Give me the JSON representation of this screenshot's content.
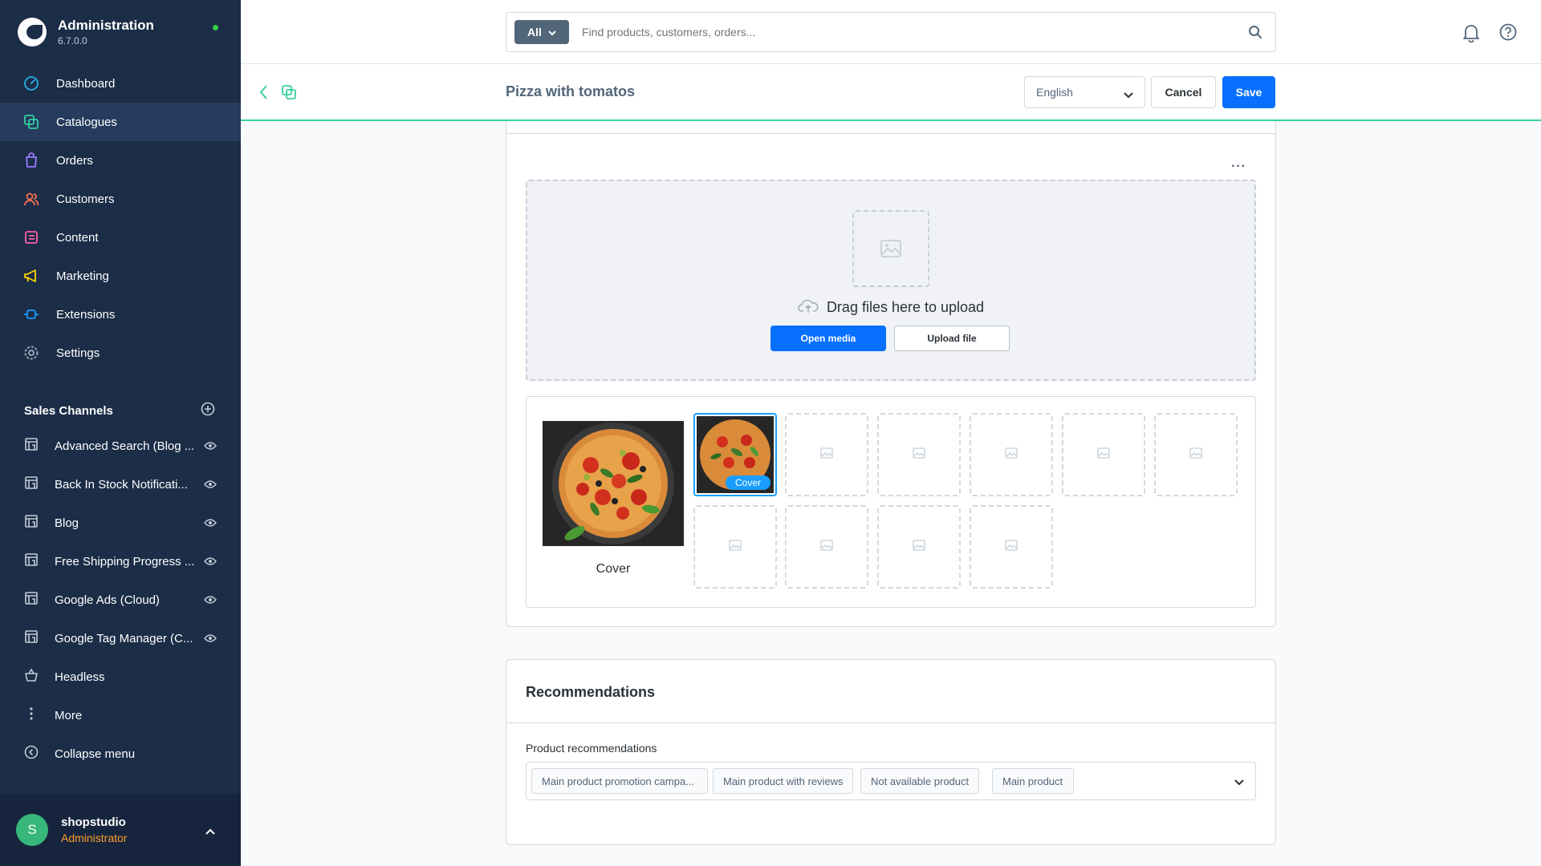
{
  "app": {
    "name": "Administration",
    "version": "6.7.0.0"
  },
  "nav": {
    "items": [
      {
        "label": "Dashboard",
        "icon": "dashboard-icon"
      },
      {
        "label": "Catalogues",
        "icon": "catalogues-icon"
      },
      {
        "label": "Orders",
        "icon": "orders-icon"
      },
      {
        "label": "Customers",
        "icon": "customers-icon"
      },
      {
        "label": "Content",
        "icon": "content-icon"
      },
      {
        "label": "Marketing",
        "icon": "marketing-icon"
      },
      {
        "label": "Extensions",
        "icon": "extensions-icon"
      },
      {
        "label": "Settings",
        "icon": "settings-icon"
      }
    ],
    "active": "Catalogues"
  },
  "sales_channels": {
    "title": "Sales Channels",
    "items": [
      {
        "label": "Advanced Search (Blog ..."
      },
      {
        "label": "Back In Stock Notificati..."
      },
      {
        "label": "Blog"
      },
      {
        "label": "Free Shipping Progress ..."
      },
      {
        "label": "Google Ads (Cloud)"
      },
      {
        "label": "Google Tag Manager (C..."
      },
      {
        "label": "Headless"
      }
    ],
    "more_label": "More",
    "collapse_label": "Collapse menu"
  },
  "user": {
    "initial": "S",
    "name": "shopstudio",
    "role": "Administrator"
  },
  "search": {
    "type": "All",
    "placeholder": "Find products, customers, orders..."
  },
  "smartbar": {
    "title": "Pizza with tomatos",
    "language": "English",
    "cancel_label": "Cancel",
    "save_label": "Save"
  },
  "media": {
    "dropzone_text": "Drag files here to upload",
    "open_media_label": "Open media",
    "upload_file_label": "Upload file",
    "cover_label": "Cover",
    "cover_badge": "Cover"
  },
  "recommendations": {
    "title": "Recommendations",
    "field_label": "Product recommendations",
    "tags": [
      "Main product promotion campa...",
      "Main product with reviews",
      "Not available product",
      "Main product"
    ]
  },
  "colors": {
    "sidebar": "#1b2d47",
    "primary": "#0870ff",
    "accent": "#37d0a0",
    "role": "#ff9d2c"
  }
}
